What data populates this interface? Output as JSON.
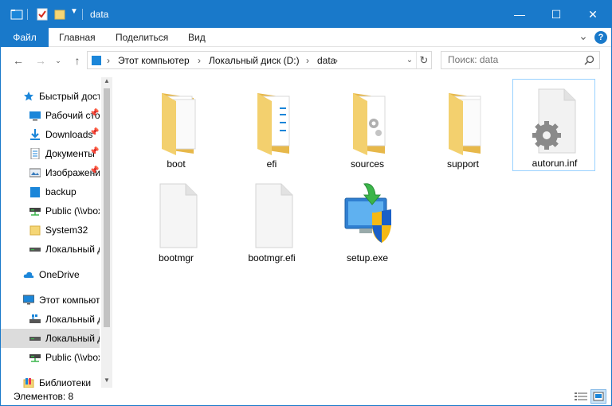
{
  "window": {
    "title": "data",
    "accent": "#1979ca",
    "controls": {
      "minimize": "—",
      "maximize": "☐",
      "close": "✕"
    }
  },
  "ribbon": {
    "tabs": [
      "Файл",
      "Главная",
      "Поделиться",
      "Вид"
    ],
    "expand_glyph": "⌄",
    "help_glyph": "?"
  },
  "address": {
    "breadcrumbs": [
      "Этот компьютер",
      "Локальный диск (D:)",
      "data"
    ],
    "separator": "›",
    "search_placeholder": "Поиск: data"
  },
  "navpane": {
    "items": [
      {
        "label": "Быстрый доступ",
        "icon": "star-icon",
        "pinned": false
      },
      {
        "label": "Рабочий стол",
        "icon": "desktop-icon",
        "pinned": true
      },
      {
        "label": "Downloads",
        "icon": "download-icon",
        "pinned": true
      },
      {
        "label": "Документы",
        "icon": "documents-icon",
        "pinned": true
      },
      {
        "label": "Изображения",
        "icon": "pictures-icon",
        "pinned": true
      },
      {
        "label": "backup",
        "icon": "folder-blue-icon",
        "pinned": false
      },
      {
        "label": "Public (\\\\vboxsrv)",
        "icon": "network-drive-icon",
        "pinned": false
      },
      {
        "label": "System32",
        "icon": "folder-icon",
        "pinned": false
      },
      {
        "label": "Локальный диск",
        "icon": "drive-icon",
        "pinned": false
      },
      {
        "label": "OneDrive",
        "icon": "onedrive-icon",
        "pinned": false
      },
      {
        "label": "Этот компьютер",
        "icon": "computer-icon",
        "pinned": false
      },
      {
        "label": "Локальный диск (C:)",
        "icon": "system-drive-icon",
        "pinned": false
      },
      {
        "label": "Локальный диск (D:)",
        "icon": "drive-icon",
        "pinned": false
      },
      {
        "label": "Public (\\\\vboxsrv)",
        "icon": "network-drive-icon",
        "pinned": false
      },
      {
        "label": "Библиотеки",
        "icon": "libraries-icon",
        "pinned": false
      }
    ],
    "selected_index": 12
  },
  "files": [
    {
      "name": "boot",
      "type": "folder"
    },
    {
      "name": "efi",
      "type": "folder"
    },
    {
      "name": "sources",
      "type": "folder"
    },
    {
      "name": "support",
      "type": "folder"
    },
    {
      "name": "autorun.inf",
      "type": "settings-file"
    },
    {
      "name": "bootmgr",
      "type": "file"
    },
    {
      "name": "bootmgr.efi",
      "type": "file"
    },
    {
      "name": "setup.exe",
      "type": "setup"
    }
  ],
  "status": {
    "items_text": "Элементов: 8"
  }
}
